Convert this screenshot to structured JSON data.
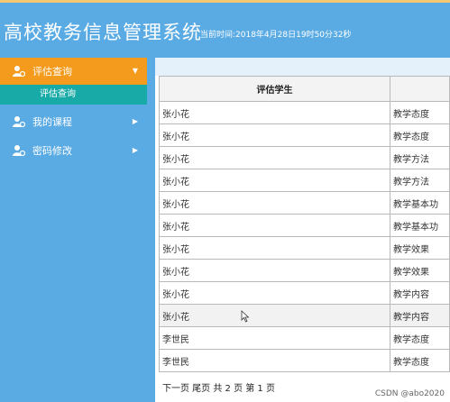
{
  "header": {
    "title": "高校教务信息管理系统",
    "time_label": "当前时间:2018年4月28日19时50分32秒"
  },
  "sidebar": {
    "items": [
      {
        "label": "评估查询",
        "arrow": "▼",
        "icon": "user-icon"
      },
      {
        "label": "我的课程",
        "arrow": "▶",
        "icon": "user-icon"
      },
      {
        "label": "密码修改",
        "arrow": "▶",
        "icon": "user-icon"
      }
    ],
    "submenu": [
      {
        "label": "评估查询"
      }
    ]
  },
  "table": {
    "headers": [
      "评估学生",
      ""
    ],
    "rows": [
      [
        "张小花",
        "教学态度"
      ],
      [
        "张小花",
        "教学态度"
      ],
      [
        "张小花",
        "教学方法"
      ],
      [
        "张小花",
        "教学方法"
      ],
      [
        "张小花",
        "教学基本功"
      ],
      [
        "张小花",
        "教学基本功"
      ],
      [
        "张小花",
        "教学效果"
      ],
      [
        "张小花",
        "教学效果"
      ],
      [
        "张小花",
        "教学内容"
      ],
      [
        "张小花",
        "教学内容"
      ],
      [
        "李世民",
        "教学态度"
      ],
      [
        "李世民",
        "教学态度"
      ]
    ]
  },
  "pager": {
    "text": "下一页 尾页 共 2 页 第 1 页"
  },
  "watermark": "CSDN @abo2020",
  "colors": {
    "header_bg": "#5aabe4",
    "active_menu": "#f49a1c",
    "submenu_bg": "#18aaa6"
  }
}
